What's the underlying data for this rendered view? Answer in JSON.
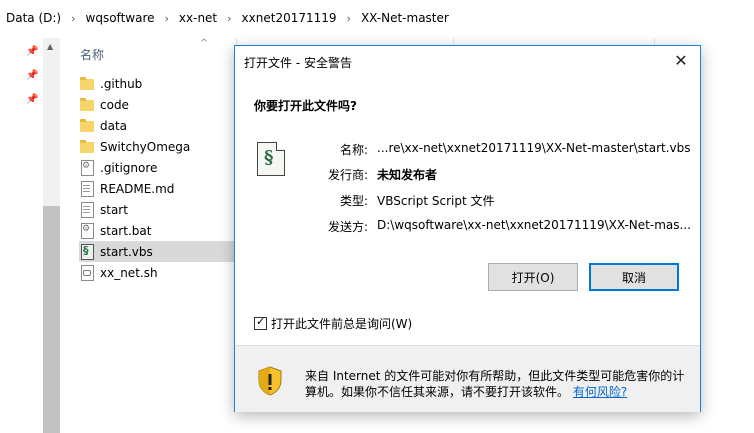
{
  "breadcrumb": [
    "Data (D:)",
    "wqsoftware",
    "xx-net",
    "xxnet20171119",
    "XX-Net-master"
  ],
  "explorer": {
    "column_name": "名称",
    "files": [
      {
        "name": ".github",
        "icon": "folder"
      },
      {
        "name": "code",
        "icon": "folder"
      },
      {
        "name": "data",
        "icon": "folder"
      },
      {
        "name": "SwitchyOmega",
        "icon": "folder"
      },
      {
        "name": ".gitignore",
        "icon": "gear"
      },
      {
        "name": "README.md",
        "icon": "doc"
      },
      {
        "name": "start",
        "icon": "doc"
      },
      {
        "name": "start.bat",
        "icon": "gear"
      },
      {
        "name": "start.vbs",
        "icon": "script",
        "selected": true
      },
      {
        "name": "xx_net.sh",
        "icon": "sh"
      }
    ]
  },
  "dialog": {
    "title": "打开文件 - 安全警告",
    "question": "你要打开此文件吗?",
    "name_label": "名称:",
    "name_value": "...re\\xx-net\\xxnet20171119\\XX-Net-master\\start.vbs",
    "publisher_label": "发行商:",
    "publisher_value": "未知发布者",
    "type_label": "类型:",
    "type_value": "VBScript Script 文件",
    "from_label": "发送方:",
    "from_value": "D:\\wqsoftware\\xx-net\\xxnet20171119\\XX-Net-mas...",
    "open_button": "打开(O)",
    "cancel_button": "取消",
    "always_ask_label": "打开此文件前总是询问(W)",
    "always_ask_checked": true,
    "warning_text": "来自 Internet 的文件可能对你有所帮助，但此文件类型可能危害你的计算机。如果你不信任其来源，请不要打开该软件。",
    "risk_link": "有何风险?"
  },
  "colors": {
    "accent": "#0078d7",
    "selection": "#d9d9d9",
    "link": "#0066cc",
    "shield_yellow": "#f6c12a"
  }
}
